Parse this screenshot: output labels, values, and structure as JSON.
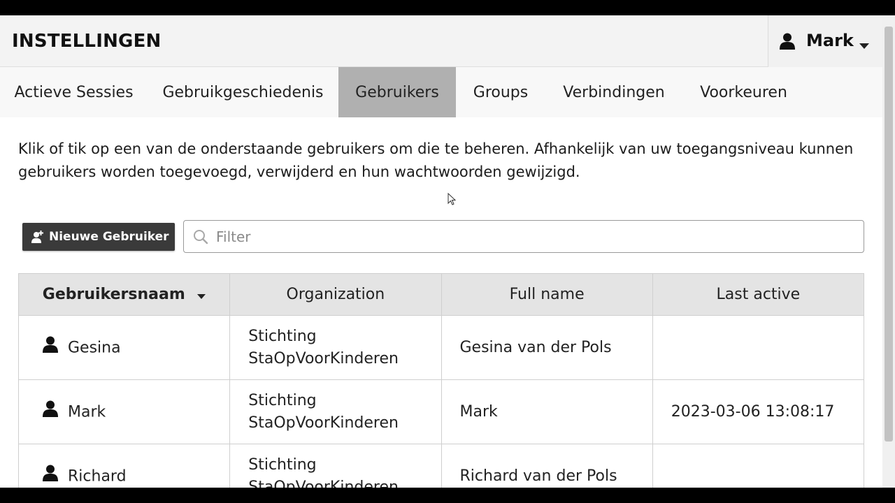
{
  "header": {
    "title": "INSTELLINGEN",
    "user_name": "Mark"
  },
  "tabs": [
    {
      "label": "Actieve Sessies",
      "active": false
    },
    {
      "label": "Gebruikgeschiedenis",
      "active": false
    },
    {
      "label": "Gebruikers",
      "active": true
    },
    {
      "label": "Groups",
      "active": false
    },
    {
      "label": "Verbindingen",
      "active": false
    },
    {
      "label": "Voorkeuren",
      "active": false
    }
  ],
  "description": "Klik of tik op een van de onderstaande gebruikers om die te beheren. Afhankelijk van uw toegangsniveau kunnen gebruikers worden toegevoegd, verwijderd en hun wachtwoorden gewijzigd.",
  "toolbar": {
    "new_user_label": "Nieuwe Gebruiker",
    "filter_placeholder": "Filter"
  },
  "table": {
    "columns": [
      "Gebruikersnaam",
      "Organization",
      "Full name",
      "Last active"
    ],
    "rows": [
      {
        "username": "Gesina",
        "organization": "Stichting StaOpVoorKinderen",
        "full_name": "Gesina van der Pols",
        "last_active": ""
      },
      {
        "username": "Mark",
        "organization": "Stichting StaOpVoorKinderen",
        "full_name": "Mark",
        "last_active": "2023-03-06 13:08:17"
      },
      {
        "username": "Richard",
        "organization": "Stichting StaOpVoorKinderen",
        "full_name": "Richard van der Pols",
        "last_active": ""
      }
    ]
  },
  "colors": {
    "active_tab": "#b0b0b0",
    "button_bg": "#3a3a3a",
    "header_bg": "#f3f3f3"
  },
  "icons": {
    "user_menu": "person-icon",
    "dropdown": "caret-down-icon",
    "new_user": "add-user-icon",
    "filter": "search-icon",
    "row": "person-icon"
  }
}
